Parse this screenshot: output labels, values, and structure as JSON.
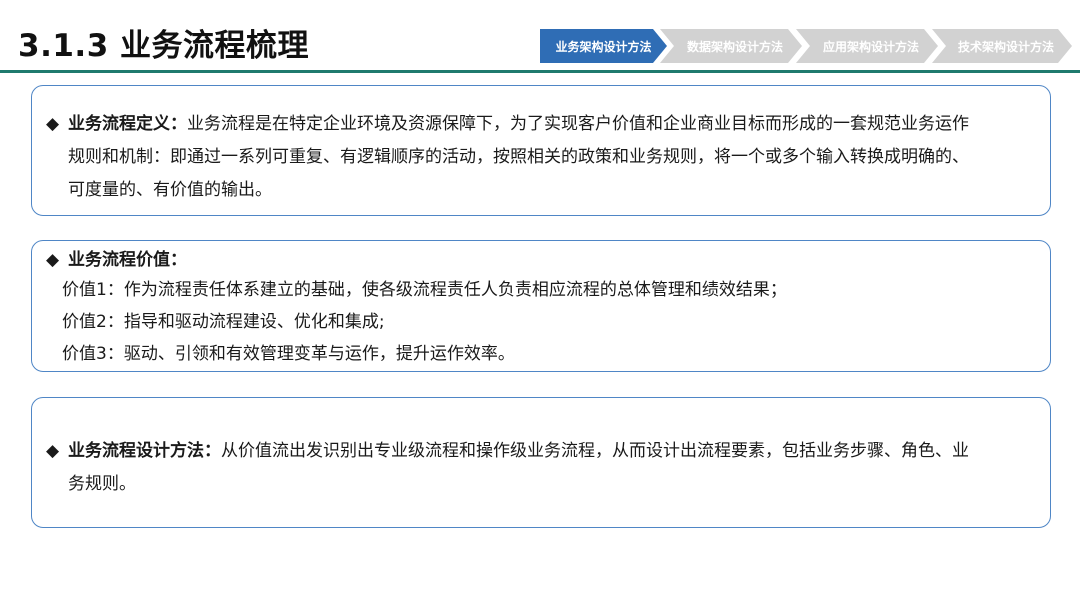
{
  "header": {
    "title": "3.1.3 业务流程梳理"
  },
  "steps": [
    {
      "label": "业务架构设计方法",
      "active": true
    },
    {
      "label": "数据架构设计方法",
      "active": false
    },
    {
      "label": "应用架构设计方法",
      "active": false
    },
    {
      "label": "技术架构设计方法",
      "active": false
    }
  ],
  "colors": {
    "accent": "#1f7a6e",
    "step_active": "#2f6db5",
    "step_inactive": "#d2d2d2",
    "card_border": "#4f86c6"
  },
  "cards": {
    "definition": {
      "bullet": "◆",
      "heading": "业务流程定义：",
      "line1": "业务流程是在特定企业环境及资源保障下，为了实现客户价值和企业商业目标而形成的一套规范业务运作",
      "line2": "规则和机制：即通过一系列可重复、有逻辑顺序的活动，按照相关的政策和业务规则，将一个或多个输入转换成明确的、",
      "line3": "可度量的、有价值的输出。"
    },
    "value": {
      "bullet": "◆",
      "heading": "业务流程价值：",
      "items": [
        "价值1：作为流程责任体系建立的基础，使各级流程责任人负责相应流程的总体管理和绩效结果；",
        "价值2：指导和驱动流程建设、优化和集成;",
        "价值3：驱动、引领和有效管理变革与运作，提升运作效率。"
      ]
    },
    "method": {
      "bullet": "◆",
      "heading": "业务流程设计方法：",
      "line1": "从价值流出发识别出专业级流程和操作级业务流程，从而设计出流程要素，包括业务步骤、角色、业",
      "line2": "务规则。"
    }
  }
}
